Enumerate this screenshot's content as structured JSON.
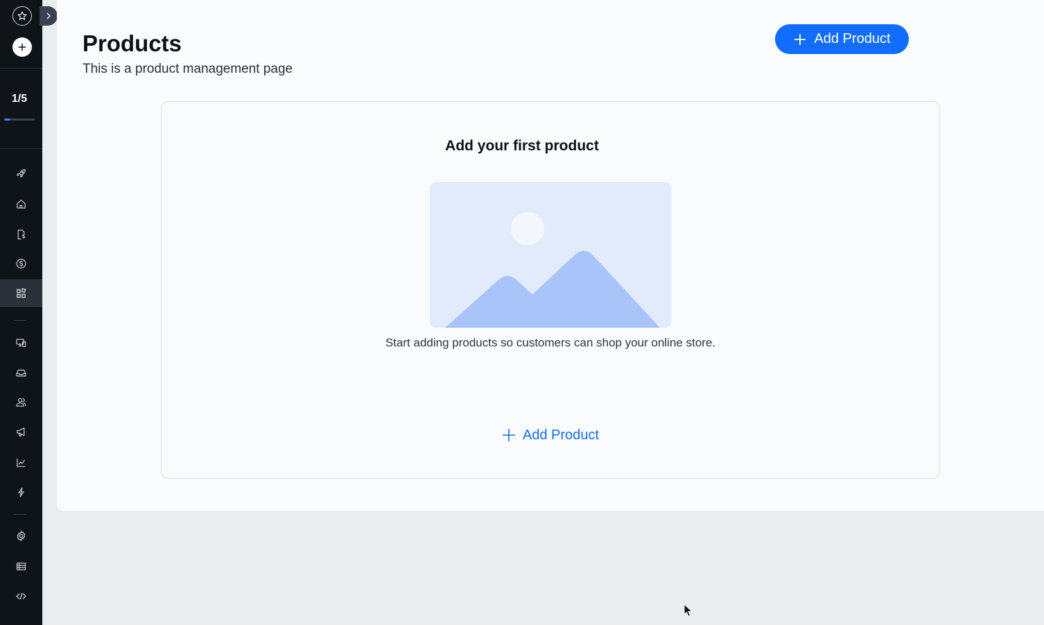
{
  "sidebar": {
    "progress_text": "1/5",
    "progress_fraction": 0.2,
    "icons": [
      "star-icon",
      "plus-icon",
      "rocket-icon",
      "home-icon",
      "sales-icon",
      "dollar-icon",
      "apps-icon",
      "devices-icon",
      "inbox-icon",
      "contacts-icon",
      "megaphone-icon",
      "analytics-icon",
      "automation-icon",
      "settings-icon",
      "table-icon",
      "code-icon"
    ],
    "active_item": "apps-icon"
  },
  "header": {
    "title": "Products",
    "subtitle": "This is a product management page",
    "add_button_label": "Add Product"
  },
  "empty_state": {
    "title": "Add your first product",
    "description": "Start adding products so customers can shop your online store.",
    "add_button_label": "Add Product"
  },
  "colors": {
    "accent": "#116dff",
    "sidebar_bg": "#0f1419",
    "page_bg": "#fafbfc",
    "illustration_bg": "#e2ebfb",
    "illustration_fg": "#a8c4f8"
  }
}
